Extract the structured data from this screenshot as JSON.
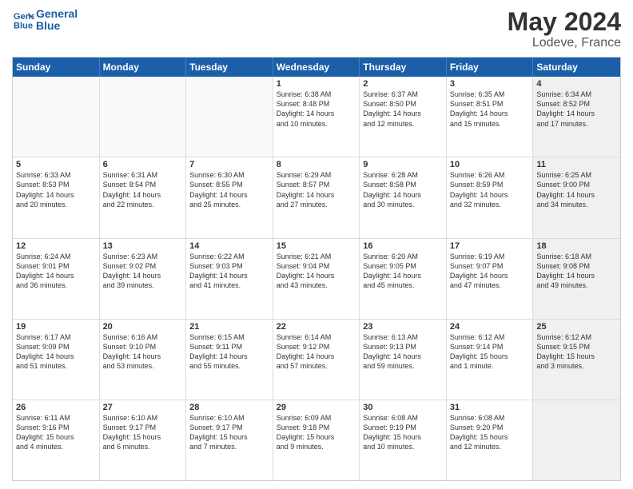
{
  "logo": {
    "line1": "General",
    "line2": "Blue"
  },
  "title": "May 2024",
  "location": "Lodeve, France",
  "header_days": [
    "Sunday",
    "Monday",
    "Tuesday",
    "Wednesday",
    "Thursday",
    "Friday",
    "Saturday"
  ],
  "weeks": [
    [
      {
        "day": "",
        "empty": true
      },
      {
        "day": "",
        "empty": true
      },
      {
        "day": "",
        "empty": true
      },
      {
        "day": "1",
        "info": "Sunrise: 6:38 AM\nSunset: 8:48 PM\nDaylight: 14 hours\nand 10 minutes."
      },
      {
        "day": "2",
        "info": "Sunrise: 6:37 AM\nSunset: 8:50 PM\nDaylight: 14 hours\nand 12 minutes."
      },
      {
        "day": "3",
        "info": "Sunrise: 6:35 AM\nSunset: 8:51 PM\nDaylight: 14 hours\nand 15 minutes."
      },
      {
        "day": "4",
        "info": "Sunrise: 6:34 AM\nSunset: 8:52 PM\nDaylight: 14 hours\nand 17 minutes.",
        "shaded": true
      }
    ],
    [
      {
        "day": "5",
        "info": "Sunrise: 6:33 AM\nSunset: 8:53 PM\nDaylight: 14 hours\nand 20 minutes."
      },
      {
        "day": "6",
        "info": "Sunrise: 6:31 AM\nSunset: 8:54 PM\nDaylight: 14 hours\nand 22 minutes."
      },
      {
        "day": "7",
        "info": "Sunrise: 6:30 AM\nSunset: 8:55 PM\nDaylight: 14 hours\nand 25 minutes."
      },
      {
        "day": "8",
        "info": "Sunrise: 6:29 AM\nSunset: 8:57 PM\nDaylight: 14 hours\nand 27 minutes."
      },
      {
        "day": "9",
        "info": "Sunrise: 6:28 AM\nSunset: 8:58 PM\nDaylight: 14 hours\nand 30 minutes."
      },
      {
        "day": "10",
        "info": "Sunrise: 6:26 AM\nSunset: 8:59 PM\nDaylight: 14 hours\nand 32 minutes."
      },
      {
        "day": "11",
        "info": "Sunrise: 6:25 AM\nSunset: 9:00 PM\nDaylight: 14 hours\nand 34 minutes.",
        "shaded": true
      }
    ],
    [
      {
        "day": "12",
        "info": "Sunrise: 6:24 AM\nSunset: 9:01 PM\nDaylight: 14 hours\nand 36 minutes."
      },
      {
        "day": "13",
        "info": "Sunrise: 6:23 AM\nSunset: 9:02 PM\nDaylight: 14 hours\nand 39 minutes."
      },
      {
        "day": "14",
        "info": "Sunrise: 6:22 AM\nSunset: 9:03 PM\nDaylight: 14 hours\nand 41 minutes."
      },
      {
        "day": "15",
        "info": "Sunrise: 6:21 AM\nSunset: 9:04 PM\nDaylight: 14 hours\nand 43 minutes."
      },
      {
        "day": "16",
        "info": "Sunrise: 6:20 AM\nSunset: 9:05 PM\nDaylight: 14 hours\nand 45 minutes."
      },
      {
        "day": "17",
        "info": "Sunrise: 6:19 AM\nSunset: 9:07 PM\nDaylight: 14 hours\nand 47 minutes."
      },
      {
        "day": "18",
        "info": "Sunrise: 6:18 AM\nSunset: 9:08 PM\nDaylight: 14 hours\nand 49 minutes.",
        "shaded": true
      }
    ],
    [
      {
        "day": "19",
        "info": "Sunrise: 6:17 AM\nSunset: 9:09 PM\nDaylight: 14 hours\nand 51 minutes."
      },
      {
        "day": "20",
        "info": "Sunrise: 6:16 AM\nSunset: 9:10 PM\nDaylight: 14 hours\nand 53 minutes."
      },
      {
        "day": "21",
        "info": "Sunrise: 6:15 AM\nSunset: 9:11 PM\nDaylight: 14 hours\nand 55 minutes."
      },
      {
        "day": "22",
        "info": "Sunrise: 6:14 AM\nSunset: 9:12 PM\nDaylight: 14 hours\nand 57 minutes."
      },
      {
        "day": "23",
        "info": "Sunrise: 6:13 AM\nSunset: 9:13 PM\nDaylight: 14 hours\nand 59 minutes."
      },
      {
        "day": "24",
        "info": "Sunrise: 6:12 AM\nSunset: 9:14 PM\nDaylight: 15 hours\nand 1 minute."
      },
      {
        "day": "25",
        "info": "Sunrise: 6:12 AM\nSunset: 9:15 PM\nDaylight: 15 hours\nand 3 minutes.",
        "shaded": true
      }
    ],
    [
      {
        "day": "26",
        "info": "Sunrise: 6:11 AM\nSunset: 9:16 PM\nDaylight: 15 hours\nand 4 minutes."
      },
      {
        "day": "27",
        "info": "Sunrise: 6:10 AM\nSunset: 9:17 PM\nDaylight: 15 hours\nand 6 minutes."
      },
      {
        "day": "28",
        "info": "Sunrise: 6:10 AM\nSunset: 9:17 PM\nDaylight: 15 hours\nand 7 minutes."
      },
      {
        "day": "29",
        "info": "Sunrise: 6:09 AM\nSunset: 9:18 PM\nDaylight: 15 hours\nand 9 minutes."
      },
      {
        "day": "30",
        "info": "Sunrise: 6:08 AM\nSunset: 9:19 PM\nDaylight: 15 hours\nand 10 minutes."
      },
      {
        "day": "31",
        "info": "Sunrise: 6:08 AM\nSunset: 9:20 PM\nDaylight: 15 hours\nand 12 minutes."
      },
      {
        "day": "",
        "empty": true,
        "shaded": true
      }
    ]
  ]
}
